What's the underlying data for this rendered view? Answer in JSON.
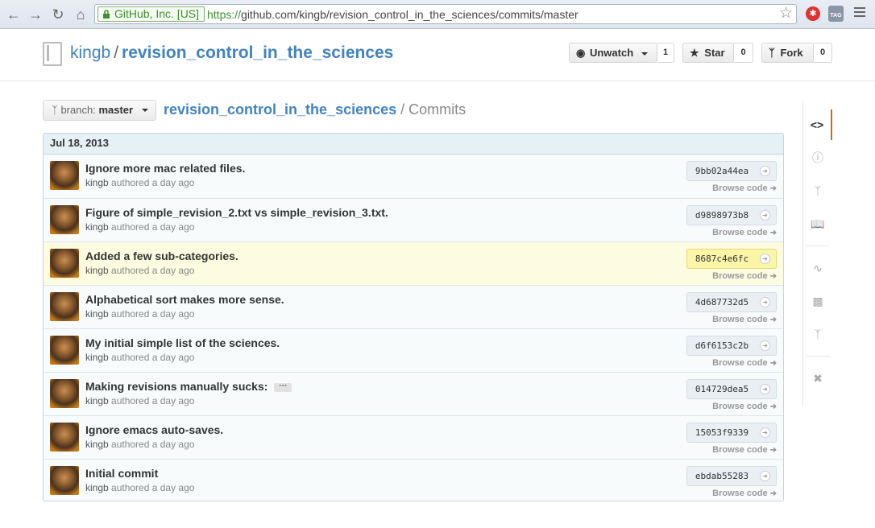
{
  "browser": {
    "ev_label": "GitHub, Inc. [US]",
    "url_scheme": "https://",
    "url_rest": "github.com/kingb/revision_control_in_the_sciences/commits/master",
    "icons": [
      "back-icon",
      "forward-icon",
      "reload-icon",
      "home-icon",
      "lock-icon",
      "star-icon",
      "extension-icon",
      "tag-extension-icon",
      "menu-icon"
    ],
    "ext2_text": "TAG"
  },
  "repo": {
    "owner": "kingb",
    "separator": "/",
    "name": "revision_control_in_the_sciences",
    "watch_label": "Unwatch",
    "watch_count": "1",
    "star_label": "Star",
    "star_count": "0",
    "fork_label": "Fork",
    "fork_count": "0"
  },
  "branch": {
    "label": "branch:",
    "value": "master"
  },
  "breadcrumb": {
    "repo": "revision_control_in_the_sciences",
    "section": "/ Commits"
  },
  "commit_group": {
    "date": "Jul 18, 2013",
    "browse_label": "Browse code",
    "commits": [
      {
        "message": "Ignore more mac related files.",
        "author": "kingb",
        "time": "authored a day ago",
        "sha": "9bb02a44ea",
        "has_more": false
      },
      {
        "message": "Figure of simple_revision_2.txt vs simple_revision_3.txt.",
        "author": "kingb",
        "time": "authored a day ago",
        "sha": "d9898973b8",
        "has_more": false
      },
      {
        "message": "Added a few sub-categories.",
        "author": "kingb",
        "time": "authored a day ago",
        "sha": "8687c4e6fc",
        "has_more": false
      },
      {
        "message": "Alphabetical sort makes more sense.",
        "author": "kingb",
        "time": "authored a day ago",
        "sha": "4d687732d5",
        "has_more": false
      },
      {
        "message": "My initial simple list of the sciences.",
        "author": "kingb",
        "time": "authored a day ago",
        "sha": "d6f6153c2b",
        "has_more": false
      },
      {
        "message": "Making revisions manually sucks:",
        "author": "kingb",
        "time": "authored a day ago",
        "sha": "014729dea5",
        "has_more": true
      },
      {
        "message": "Ignore emacs auto-saves.",
        "author": "kingb",
        "time": "authored a day ago",
        "sha": "15053f9339",
        "has_more": false
      },
      {
        "message": "Initial commit",
        "author": "kingb",
        "time": "authored a day ago",
        "sha": "ebdab55283",
        "has_more": false
      }
    ]
  },
  "sidenav": {
    "items": [
      "code-icon",
      "issues-icon",
      "pull-requests-icon",
      "wiki-icon",
      "pulse-icon",
      "graphs-icon",
      "network-icon",
      "settings-icon"
    ],
    "selected": "code-icon"
  }
}
